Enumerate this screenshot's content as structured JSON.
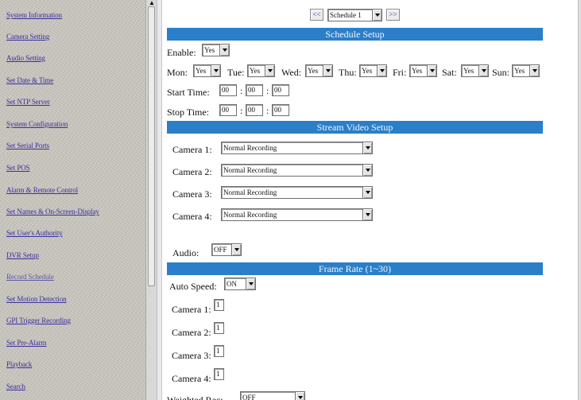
{
  "sidebar": {
    "items": [
      {
        "label": "System Information"
      },
      {
        "label": "Camera Setting"
      },
      {
        "label": "Audio Setting"
      },
      {
        "label": "Set Date & Time"
      },
      {
        "label": "Set NTP Server"
      },
      {
        "label": "System Configuration"
      },
      {
        "label": "Set Serial Ports"
      },
      {
        "label": "Set POS"
      },
      {
        "label": "Alarm & Remote Control"
      },
      {
        "label": "Set Names & On-Screen-Display"
      },
      {
        "label": "Set User's Authority"
      },
      {
        "label": "DVR Setup"
      },
      {
        "label": "Record Schedule"
      },
      {
        "label": "Set Motion Detection"
      },
      {
        "label": "GPI Trigger Recording"
      },
      {
        "label": "Set Pre-Alarm"
      },
      {
        "label": "Playback"
      },
      {
        "label": "Search"
      }
    ],
    "current_index": 12
  },
  "schedule_nav": {
    "prev_label": "<<",
    "next_label": ">>",
    "selected": "Schedule 1"
  },
  "schedule_setup": {
    "title": "Schedule Setup",
    "enable_label": "Enable:",
    "enable_value": "Yes",
    "days": [
      {
        "label": "Mon:",
        "value": "Yes"
      },
      {
        "label": "Tue:",
        "value": "Yes"
      },
      {
        "label": "Wed:",
        "value": "Yes"
      },
      {
        "label": "Thu:",
        "value": "Yes"
      },
      {
        "label": "Fri:",
        "value": "Yes"
      },
      {
        "label": "Sat:",
        "value": "Yes"
      },
      {
        "label": "Sun:",
        "value": "Yes"
      }
    ],
    "start_time_label": "Start Time:",
    "start_time": [
      "00",
      "00",
      "00"
    ],
    "stop_time_label": "Stop Time:",
    "stop_time": [
      "00",
      "00",
      "00"
    ],
    "time_sep": ":"
  },
  "stream_video_setup": {
    "title": "Stream Video Setup",
    "cameras": [
      {
        "label": "Camera 1:",
        "value": "Normal Recording"
      },
      {
        "label": "Camera 2:",
        "value": "Normal Recording"
      },
      {
        "label": "Camera 3:",
        "value": "Normal Recording"
      },
      {
        "label": "Camera 4:",
        "value": "Normal Recording"
      }
    ],
    "audio_label": "Audio:",
    "audio_value": "OFF"
  },
  "frame_rate": {
    "title": "Frame Rate (1~30)",
    "auto_speed_label": "Auto Speed:",
    "auto_speed_value": "ON",
    "cameras": [
      {
        "label": "Camera 1:",
        "value": "1"
      },
      {
        "label": "Camera 2:",
        "value": "1"
      },
      {
        "label": "Camera 3:",
        "value": "1"
      },
      {
        "label": "Camera 4:",
        "value": "1"
      }
    ],
    "weighted_label": "Weighted Rec:",
    "weighted_value": "OFF"
  }
}
